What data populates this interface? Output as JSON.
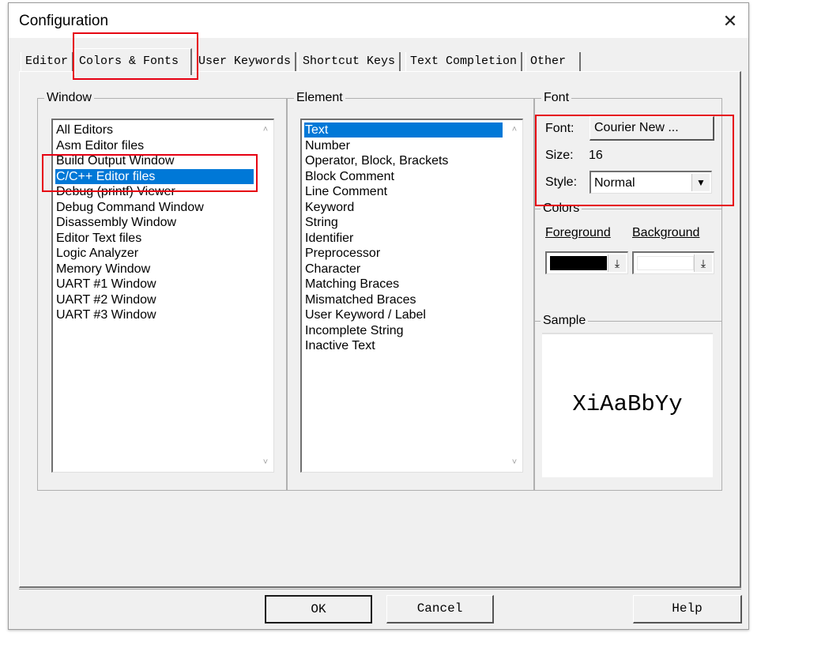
{
  "window": {
    "title": "Configuration"
  },
  "tabs": [
    {
      "label": "Editor"
    },
    {
      "label": "Colors & Fonts"
    },
    {
      "label": "User Keywords"
    },
    {
      "label": "Shortcut Keys"
    },
    {
      "label": "Text Completion"
    },
    {
      "label": "Other"
    }
  ],
  "window_group": {
    "label": "Window",
    "items": [
      "All Editors",
      "Asm Editor files",
      "Build Output Window",
      "C/C++ Editor files",
      "Debug (printf) Viewer",
      "Debug Command Window",
      "Disassembly Window",
      "Editor Text files",
      "Logic Analyzer",
      "Memory Window",
      "UART #1 Window",
      "UART #2 Window",
      "UART #3 Window"
    ],
    "selected": "C/C++ Editor files"
  },
  "element_group": {
    "label": "Element",
    "items": [
      "Text",
      "Number",
      "Operator, Block, Brackets",
      "Block Comment",
      "Line Comment",
      "Keyword",
      "String",
      "Identifier",
      "Preprocessor",
      "Character",
      "Matching Braces",
      "Mismatched Braces",
      "User Keyword / Label",
      "Incomplete String",
      "Inactive Text"
    ],
    "selected": "Text"
  },
  "font_group": {
    "label": "Font",
    "font_label": "Font:",
    "font_button": "Courier New ...",
    "size_label": "Size:",
    "size_value": "16",
    "style_label": "Style:",
    "style_value": "Normal"
  },
  "colors_group": {
    "label": "Colors",
    "foreground_label": "Foreground",
    "background_label": "Background",
    "foreground_color": "#000000",
    "background_color": "#ffffff"
  },
  "sample_group": {
    "label": "Sample",
    "text": "XiAaBbYy"
  },
  "buttons": {
    "ok": "OK",
    "cancel": "Cancel",
    "help": "Help"
  },
  "highlight_color": "#e60012"
}
